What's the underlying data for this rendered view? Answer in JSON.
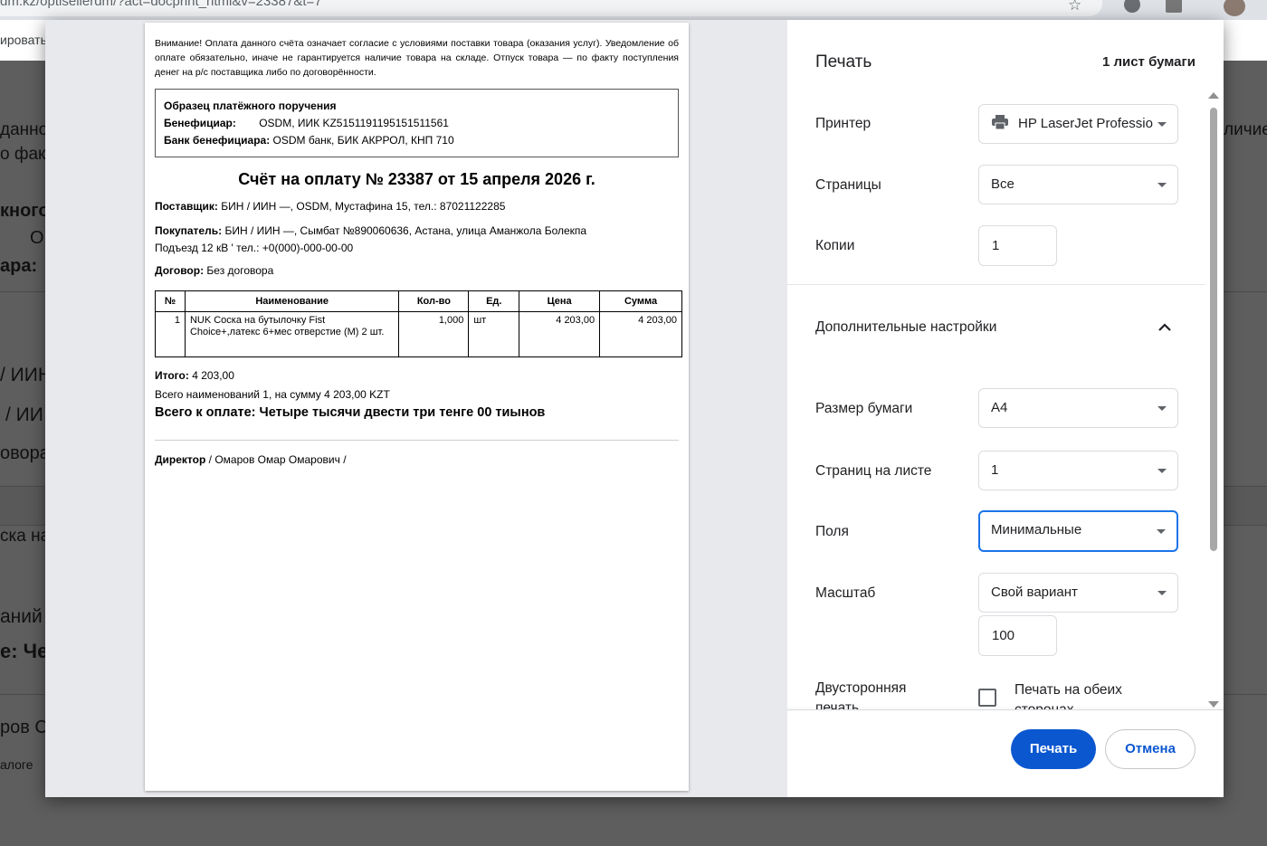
{
  "browser": {
    "url": "dm.kz/optisellerdm/?act=docprint_html&v=23387&t=7",
    "bookmark_text": "ировать"
  },
  "background": {
    "frag_1": "данно",
    "frag_2": "о факт",
    "frag_3": "кного",
    "frag_4": "О",
    "frag_5": "ара:",
    "frag_6": "/ ИИН",
    "frag_7": "/ ИИ",
    "frag_8": "овора",
    "frag_9": "ска на",
    "frag_10": "аний",
    "frag_11": "е: Че",
    "frag_12": "ров С",
    "frag_13": "алоге",
    "frag_right": "личие"
  },
  "document": {
    "notice": "Внимание! Оплата данного счёта означает согласие с условиями поставки товара (оказания услуг). Уведомление об оплате обязательно, иначе не гарантируется наличие товара на складе. Отпуск товара — по факту поступления денег на р/с поставщика либо по договорённости.",
    "sample_title": "Образец платёжного поручения",
    "beneficiary_label": "Бенефициар:",
    "beneficiary_value": "OSDM, ИИК KZ5151191195151511561",
    "bank_label": "Банк бенефициара:",
    "bank_value": "OSDM банк, БИК АКРРОЛ, КНП 710",
    "title": "Счёт на оплату № 23387 от 15 апреля 2026 г.",
    "supplier_label": "Поставщик:",
    "supplier_value": "БИН / ИИН —, OSDM, Мустафина 15, тел.: 87021122285",
    "buyer_label": "Покупатель:",
    "buyer_value": "БИН / ИИН —, Сымбат №890060636, Астана, улица Аманжола Болекпа",
    "buyer_value_2": "Подъезд 12 кВ      '  тел.: +0(000)-000-00-00",
    "contract_label": "Договор:",
    "contract_value": "Без договора",
    "table": {
      "headers": [
        "№",
        "Наименование",
        "Кол-во",
        "Ед.",
        "Цена",
        "Сумма"
      ],
      "rows": [
        [
          "1",
          "NUK Соска на бутылочку Fist Choice+,латекс 6+мес отверстие (M) 2 шт.",
          "1,000",
          "шт",
          "4 203,00",
          "4 203,00"
        ]
      ]
    },
    "total_label": "Итого:",
    "total_value": "4 203,00",
    "summary": "Всего наименований 1, на сумму 4 203,00 KZT",
    "grand_total": "Всего к оплате: Четыре тысячи двести три тенге 00 тиынов",
    "director_label": "Директор",
    "director_value": "/ Омаров Омар Омарович /"
  },
  "print_settings": {
    "title": "Печать",
    "sheet_count": "1 лист бумаги",
    "printer_label": "Принтер",
    "printer_value": "HP LaserJet Professio",
    "pages_label": "Страницы",
    "pages_value": "Все",
    "copies_label": "Копии",
    "copies_value": "1",
    "more_settings_label": "Дополнительные настройки",
    "paper_size_label": "Размер бумаги",
    "paper_size_value": "A4",
    "pages_per_sheet_label": "Страниц на листе",
    "pages_per_sheet_value": "1",
    "margins_label": "Поля",
    "margins_value": "Минимальные",
    "scale_label": "Масштаб",
    "scale_value": "Свой вариант",
    "scale_percent": "100",
    "duplex_label": "Двусторонняя печать",
    "duplex_checkbox_label": "Печать на обеих сторонах",
    "duplex_checked": false,
    "print_button": "Печать",
    "cancel_button": "Отмена"
  },
  "colors": {
    "accent": "#0b57d0",
    "focus": "#1a73e8",
    "overlay": "#5f5f5f"
  }
}
